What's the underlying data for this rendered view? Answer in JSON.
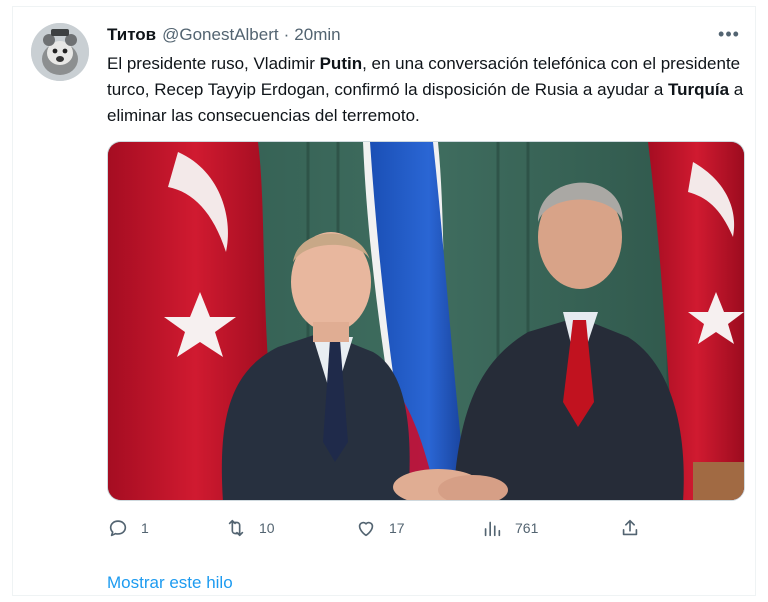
{
  "author": {
    "name": "Титов",
    "handle": "@GonestAlbert",
    "separator": "·",
    "time": "20min"
  },
  "tweet": {
    "text_1": "El presidente ruso, Vladimir ",
    "bold_1": "Putin",
    "text_2": ", en una conversación telefónica con el presidente turco, Recep Tayyip Erdogan, confirmó la disposición de Rusia a ayudar a ",
    "bold_2": "Turquía",
    "text_3": " a eliminar las consecuencias del terremoto."
  },
  "actions": {
    "reply_count": "1",
    "retweet_count": "10",
    "like_count": "17",
    "views_count": "761"
  },
  "more_label": "•••",
  "thread_link": "Mostrar este hilo",
  "colors": {
    "link": "#1d9bf0",
    "muted": "#536471",
    "text": "#0f1419",
    "flag_red": "#c8102e",
    "russia_blue": "#1c57c4"
  },
  "icons": [
    "reply-icon",
    "retweet-icon",
    "like-icon",
    "views-icon",
    "share-icon",
    "more-icon"
  ]
}
